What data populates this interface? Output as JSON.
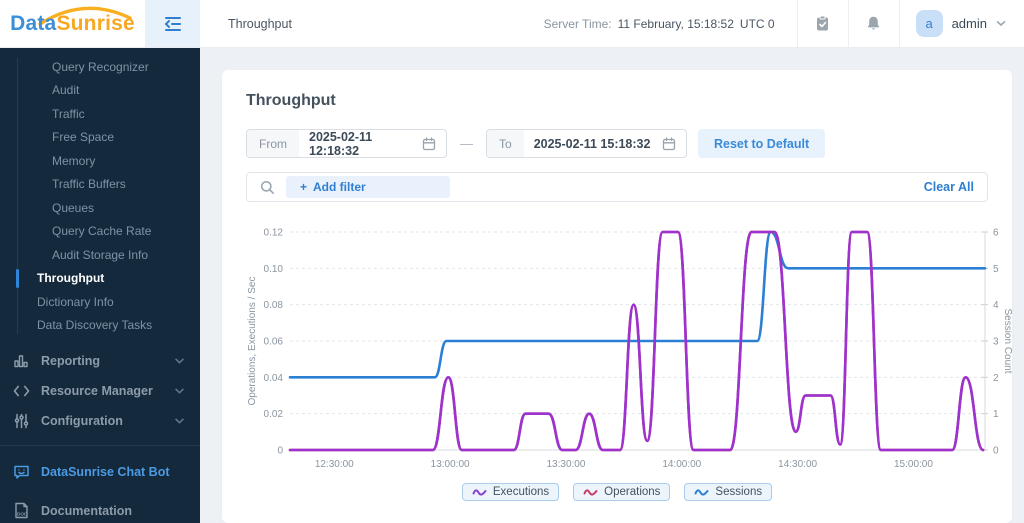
{
  "header": {
    "logo": {
      "part1": "Data",
      "part2": "Sunrise"
    },
    "page_title": "Throughput",
    "server_time_label": "Server Time:",
    "server_time_value": "11 February, 15:18:52",
    "server_time_zone": "UTC 0",
    "user": {
      "avatar_letter": "a",
      "name": "admin"
    }
  },
  "sidebar": {
    "deep_items": [
      "Query Recognizer",
      "Audit",
      "Traffic",
      "Free Space",
      "Memory",
      "Traffic Buffers",
      "Queues",
      "Query Cache Rate",
      "Audit Storage Info"
    ],
    "mid_items": [
      {
        "label": "Throughput",
        "active": true
      },
      {
        "label": "Dictionary Info",
        "active": false
      },
      {
        "label": "Data Discovery Tasks",
        "active": false
      }
    ],
    "sections": [
      {
        "label": "Reporting",
        "icon": "bar-chart-icon"
      },
      {
        "label": "Resource Manager",
        "icon": "code-icon"
      },
      {
        "label": "Configuration",
        "icon": "sliders-icon"
      }
    ],
    "links": [
      {
        "label": "DataSunrise Chat Bot",
        "icon": "chat-bot-icon",
        "highlight": true
      },
      {
        "label": "Documentation",
        "icon": "document-icon",
        "highlight": false
      }
    ]
  },
  "main": {
    "title": "Throughput",
    "date_range": {
      "from_label": "From",
      "from_value": "2025-02-11 12:18:32",
      "separator": "—",
      "to_label": "To",
      "to_value": "2025-02-11 15:18:32",
      "reset_label": "Reset to Default"
    },
    "filter": {
      "add_plus": "+",
      "add_label": "Add filter",
      "clear_label": "Clear All"
    }
  },
  "chart_data": {
    "type": "line",
    "title": "",
    "grid": {
      "horizontal_dashed": true,
      "vertical": false
    },
    "x_axis": {
      "start_time": "12:18:32",
      "end_time": "15:18:32",
      "total_minutes": 180,
      "tick_labels": [
        "12:30:00",
        "13:00:00",
        "13:30:00",
        "14:00:00",
        "14:30:00",
        "15:00:00"
      ],
      "tick_minutes_from_start": [
        11.47,
        41.47,
        71.47,
        101.47,
        131.47,
        161.47
      ]
    },
    "left_axis": {
      "label": "Operations, Executions / Sec",
      "min": 0,
      "max": 0.12,
      "tick_labels": [
        "0",
        "0.02",
        "0.04",
        "0.06",
        "0.08",
        "0.10",
        "0.12"
      ]
    },
    "right_axis": {
      "label": "Session Count",
      "min": 0,
      "max": 6,
      "tick_labels": [
        "0",
        "1",
        "2",
        "3",
        "4",
        "5",
        "6"
      ]
    },
    "series": [
      {
        "name": "Sessions",
        "color": "#2b80d5",
        "axis": "right",
        "points": [
          [
            0,
            2
          ],
          [
            37.5,
            2
          ],
          [
            40.5,
            3
          ],
          [
            121,
            3
          ],
          [
            124.5,
            6
          ],
          [
            129,
            5
          ],
          [
            180,
            5
          ]
        ]
      },
      {
        "name": "Operations",
        "color": "#c63f63",
        "axis": "left",
        "hidden_behind": "Executions",
        "points": [
          [
            0,
            0
          ],
          [
            37,
            0
          ],
          [
            41,
            0.04
          ],
          [
            44.5,
            0
          ],
          [
            58,
            0
          ],
          [
            61,
            0.02
          ],
          [
            67,
            0.02
          ],
          [
            70.5,
            0
          ],
          [
            74,
            0
          ],
          [
            77.5,
            0.02
          ],
          [
            81,
            0
          ],
          [
            85.5,
            0
          ],
          [
            89,
            0.08
          ],
          [
            92.5,
            0.005
          ],
          [
            96.5,
            0.12
          ],
          [
            100.5,
            0.12
          ],
          [
            104.5,
            0
          ],
          [
            114,
            0
          ],
          [
            119.5,
            0.12
          ],
          [
            125.5,
            0.12
          ],
          [
            131,
            0.01
          ],
          [
            133.5,
            0.03
          ],
          [
            140,
            0.03
          ],
          [
            142.5,
            0.003
          ],
          [
            145.5,
            0.12
          ],
          [
            149.5,
            0.12
          ],
          [
            153,
            0
          ],
          [
            171.5,
            0
          ],
          [
            175,
            0.04
          ],
          [
            179.5,
            0
          ]
        ]
      },
      {
        "name": "Executions",
        "color": "#9d32d0",
        "axis": "left",
        "points": [
          [
            0,
            0
          ],
          [
            37,
            0
          ],
          [
            41,
            0.04
          ],
          [
            44.5,
            0
          ],
          [
            58,
            0
          ],
          [
            61,
            0.02
          ],
          [
            67,
            0.02
          ],
          [
            70.5,
            0
          ],
          [
            74,
            0
          ],
          [
            77.5,
            0.02
          ],
          [
            81,
            0
          ],
          [
            85.5,
            0
          ],
          [
            89,
            0.08
          ],
          [
            92.5,
            0.005
          ],
          [
            96.5,
            0.12
          ],
          [
            100.5,
            0.12
          ],
          [
            104.5,
            0
          ],
          [
            114,
            0
          ],
          [
            119.5,
            0.12
          ],
          [
            125.5,
            0.12
          ],
          [
            131,
            0.01
          ],
          [
            133.5,
            0.03
          ],
          [
            140,
            0.03
          ],
          [
            142.5,
            0.003
          ],
          [
            145.5,
            0.12
          ],
          [
            149.5,
            0.12
          ],
          [
            153,
            0
          ],
          [
            171.5,
            0
          ],
          [
            175,
            0.04
          ],
          [
            179.5,
            0
          ]
        ]
      }
    ],
    "legend": [
      {
        "label": "Executions",
        "color": "#8a3fd1"
      },
      {
        "label": "Operations",
        "color": "#c63f63"
      },
      {
        "label": "Sessions",
        "color": "#2b80d5"
      }
    ]
  }
}
